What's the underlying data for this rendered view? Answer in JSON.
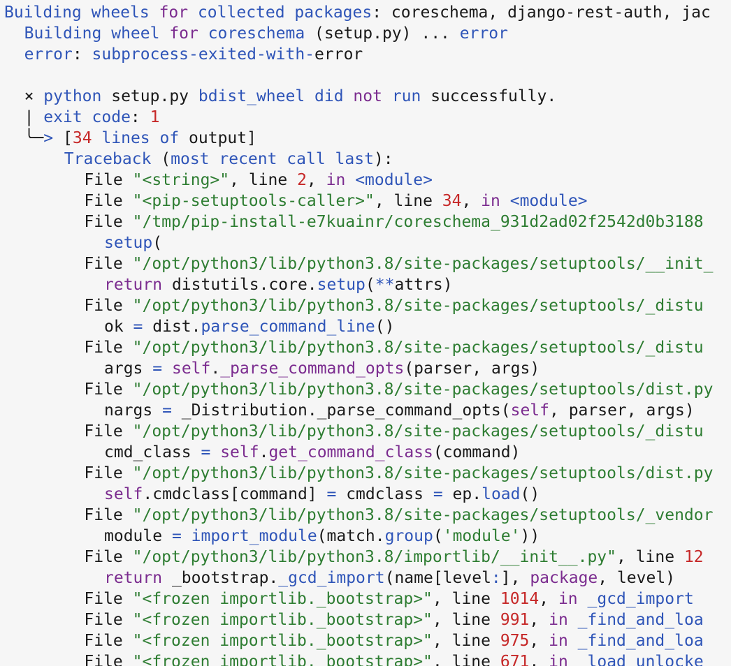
{
  "colors": {
    "background": "#f6f6f6",
    "keyword": "#7b2c8f",
    "ident": "#2f55b8",
    "string": "#2e7d32",
    "number": "#c62828",
    "text": "#1a1a1a"
  },
  "lines": [
    {
      "indent": 0,
      "segs": [
        [
          "bl",
          "Building wheels "
        ],
        [
          "kw",
          "for"
        ],
        [
          "bl",
          " collected packages"
        ],
        [
          "dk",
          ": coreschema, django-rest-auth, jac"
        ]
      ]
    },
    {
      "indent": 1,
      "segs": [
        [
          "bl",
          "Building wheel "
        ],
        [
          "kw",
          "for"
        ],
        [
          "bl",
          " coreschema "
        ],
        [
          "dk",
          "(setup.py) ... "
        ],
        [
          "bl",
          "error"
        ]
      ]
    },
    {
      "indent": 1,
      "segs": [
        [
          "bl",
          "error"
        ],
        [
          "dk",
          ": "
        ],
        [
          "bl",
          "subprocess-exited-with-"
        ],
        [
          "dk",
          "error"
        ]
      ]
    },
    {
      "indent": 0,
      "segs": []
    },
    {
      "indent": 1,
      "segs": [
        [
          "dk",
          "× "
        ],
        [
          "bl",
          "python "
        ],
        [
          "dk",
          "setup.py "
        ],
        [
          "bl",
          "bdist_wheel did "
        ],
        [
          "kw",
          "not"
        ],
        [
          "bl",
          " run "
        ],
        [
          "dk",
          "successfully."
        ]
      ]
    },
    {
      "indent": 1,
      "segs": [
        [
          "dk",
          "| "
        ],
        [
          "bl",
          "exit code"
        ],
        [
          "dk",
          ": "
        ],
        [
          "num",
          "1"
        ]
      ]
    },
    {
      "indent": 1,
      "segs": [
        [
          "dk",
          "╰─"
        ],
        [
          "bl",
          "> "
        ],
        [
          "dk",
          "["
        ],
        [
          "num",
          "34"
        ],
        [
          "bl",
          " lines of "
        ],
        [
          "dk",
          "output]"
        ]
      ]
    },
    {
      "indent": 3,
      "segs": [
        [
          "bl",
          "Traceback "
        ],
        [
          "dk",
          "("
        ],
        [
          "bl",
          "most recent call last"
        ],
        [
          "dk",
          "):"
        ]
      ]
    },
    {
      "indent": 4,
      "segs": [
        [
          "dk",
          "File "
        ],
        [
          "str",
          "\"<string>\""
        ],
        [
          "dk",
          ", line "
        ],
        [
          "num",
          "2"
        ],
        [
          "dk",
          ", "
        ],
        [
          "kw",
          "in"
        ],
        [
          "dk",
          " "
        ],
        [
          "bl",
          "<module>"
        ]
      ]
    },
    {
      "indent": 4,
      "segs": [
        [
          "dk",
          "File "
        ],
        [
          "str",
          "\"<pip-setuptools-caller>\""
        ],
        [
          "dk",
          ", line "
        ],
        [
          "num",
          "34"
        ],
        [
          "dk",
          ", "
        ],
        [
          "kw",
          "in"
        ],
        [
          "dk",
          " "
        ],
        [
          "bl",
          "<module>"
        ]
      ]
    },
    {
      "indent": 4,
      "segs": [
        [
          "dk",
          "File "
        ],
        [
          "str",
          "\"/tmp/pip-install-e7kuainr/coreschema_931d2ad02f2542d0b3188"
        ]
      ]
    },
    {
      "indent": 5,
      "segs": [
        [
          "bl",
          "setup"
        ],
        [
          "dk",
          "("
        ]
      ]
    },
    {
      "indent": 4,
      "segs": [
        [
          "dk",
          "File "
        ],
        [
          "str",
          "\"/opt/python3/lib/python3.8/site-packages/setuptools/__init_"
        ]
      ]
    },
    {
      "indent": 5,
      "segs": [
        [
          "kw",
          "return"
        ],
        [
          "dk",
          " distutils.core."
        ],
        [
          "bl",
          "setup"
        ],
        [
          "dk",
          "("
        ],
        [
          "bl",
          "**"
        ],
        [
          "dk",
          "attrs)"
        ]
      ]
    },
    {
      "indent": 4,
      "segs": [
        [
          "dk",
          "File "
        ],
        [
          "str",
          "\"/opt/python3/lib/python3.8/site-packages/setuptools/_distu"
        ]
      ]
    },
    {
      "indent": 5,
      "segs": [
        [
          "dk",
          "ok "
        ],
        [
          "bl",
          "="
        ],
        [
          "dk",
          " dist."
        ],
        [
          "bl",
          "parse_command_line"
        ],
        [
          "dk",
          "()"
        ]
      ]
    },
    {
      "indent": 4,
      "segs": [
        [
          "dk",
          "File "
        ],
        [
          "str",
          "\"/opt/python3/lib/python3.8/site-packages/setuptools/_distu"
        ]
      ]
    },
    {
      "indent": 5,
      "segs": [
        [
          "dk",
          "args "
        ],
        [
          "bl",
          "="
        ],
        [
          "dk",
          " "
        ],
        [
          "kw",
          "self"
        ],
        [
          "dk",
          "."
        ],
        [
          "kw",
          "_parse_command_opts"
        ],
        [
          "dk",
          "(parser, args)"
        ]
      ]
    },
    {
      "indent": 4,
      "segs": [
        [
          "dk",
          "File "
        ],
        [
          "str",
          "\"/opt/python3/lib/python3.8/site-packages/setuptools/dist.py"
        ]
      ]
    },
    {
      "indent": 5,
      "segs": [
        [
          "dk",
          "nargs "
        ],
        [
          "bl",
          "="
        ],
        [
          "dk",
          " _Distribution._parse_command_opts("
        ],
        [
          "kw",
          "self"
        ],
        [
          "dk",
          ", parser, args)"
        ]
      ]
    },
    {
      "indent": 4,
      "segs": [
        [
          "dk",
          "File "
        ],
        [
          "str",
          "\"/opt/python3/lib/python3.8/site-packages/setuptools/_distu"
        ]
      ]
    },
    {
      "indent": 5,
      "segs": [
        [
          "dk",
          "cmd_class "
        ],
        [
          "bl",
          "="
        ],
        [
          "dk",
          " "
        ],
        [
          "kw",
          "self"
        ],
        [
          "dk",
          "."
        ],
        [
          "kw",
          "get_command_class"
        ],
        [
          "dk",
          "(command)"
        ]
      ]
    },
    {
      "indent": 4,
      "segs": [
        [
          "dk",
          "File "
        ],
        [
          "str",
          "\"/opt/python3/lib/python3.8/site-packages/setuptools/dist.py"
        ]
      ]
    },
    {
      "indent": 5,
      "segs": [
        [
          "kw",
          "self"
        ],
        [
          "dk",
          ".cmdclass[command] "
        ],
        [
          "bl",
          "="
        ],
        [
          "dk",
          " cmdclass "
        ],
        [
          "bl",
          "="
        ],
        [
          "dk",
          " ep."
        ],
        [
          "bl",
          "load"
        ],
        [
          "dk",
          "()"
        ]
      ]
    },
    {
      "indent": 4,
      "segs": [
        [
          "dk",
          "File "
        ],
        [
          "str",
          "\"/opt/python3/lib/python3.8/site-packages/setuptools/_vendor"
        ]
      ]
    },
    {
      "indent": 5,
      "segs": [
        [
          "dk",
          "module "
        ],
        [
          "bl",
          "="
        ],
        [
          "dk",
          " "
        ],
        [
          "bl",
          "import_module"
        ],
        [
          "dk",
          "(match."
        ],
        [
          "bl",
          "group"
        ],
        [
          "dk",
          "("
        ],
        [
          "str",
          "'module'"
        ],
        [
          "dk",
          "))"
        ]
      ]
    },
    {
      "indent": 4,
      "segs": [
        [
          "dk",
          "File "
        ],
        [
          "str",
          "\"/opt/python3/lib/python3.8/importlib/__init__.py\""
        ],
        [
          "dk",
          ", line "
        ],
        [
          "num",
          "12"
        ]
      ]
    },
    {
      "indent": 5,
      "segs": [
        [
          "kw",
          "return"
        ],
        [
          "dk",
          " _bootstrap."
        ],
        [
          "bl",
          "_gcd_import"
        ],
        [
          "dk",
          "(name[level"
        ],
        [
          "bl",
          ":"
        ],
        [
          "dk",
          "], "
        ],
        [
          "kw",
          "package"
        ],
        [
          "dk",
          ", level)"
        ]
      ]
    },
    {
      "indent": 4,
      "segs": [
        [
          "dk",
          "File "
        ],
        [
          "str",
          "\"<frozen importlib._bootstrap>\""
        ],
        [
          "dk",
          ", line "
        ],
        [
          "num",
          "1014"
        ],
        [
          "dk",
          ", "
        ],
        [
          "kw",
          "in"
        ],
        [
          "dk",
          " "
        ],
        [
          "bl",
          "_gcd_import"
        ]
      ]
    },
    {
      "indent": 4,
      "segs": [
        [
          "dk",
          "File "
        ],
        [
          "str",
          "\"<frozen importlib._bootstrap>\""
        ],
        [
          "dk",
          ", line "
        ],
        [
          "num",
          "991"
        ],
        [
          "dk",
          ", "
        ],
        [
          "kw",
          "in"
        ],
        [
          "dk",
          " "
        ],
        [
          "bl",
          "_find_and_loa"
        ]
      ]
    },
    {
      "indent": 4,
      "segs": [
        [
          "dk",
          "File "
        ],
        [
          "str",
          "\"<frozen importlib._bootstrap>\""
        ],
        [
          "dk",
          ", line "
        ],
        [
          "num",
          "975"
        ],
        [
          "dk",
          ", "
        ],
        [
          "kw",
          "in"
        ],
        [
          "dk",
          " "
        ],
        [
          "bl",
          "_find_and_loa"
        ]
      ]
    },
    {
      "indent": 4,
      "segs": [
        [
          "dk",
          "File "
        ],
        [
          "str",
          "\"<frozen importlib._bootstrap>\""
        ],
        [
          "dk",
          ", line "
        ],
        [
          "num",
          "671"
        ],
        [
          "dk",
          ", "
        ],
        [
          "kw",
          "in"
        ],
        [
          "dk",
          " "
        ],
        [
          "bl",
          "_load_unlocke"
        ]
      ]
    }
  ]
}
